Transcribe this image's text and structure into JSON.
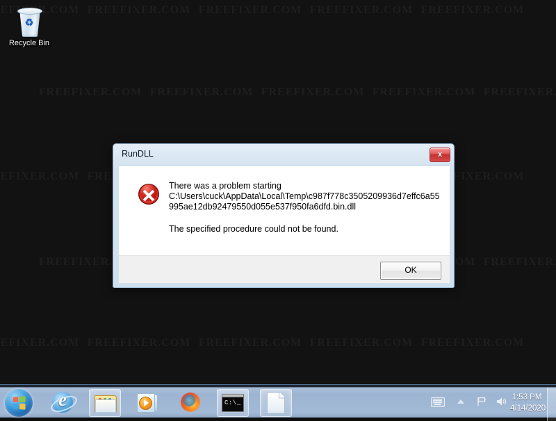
{
  "desktop": {
    "watermark_text": "FREEFIXER.COM",
    "background_color": "#121212",
    "icons": [
      {
        "name": "recycle-bin",
        "label": "Recycle Bin"
      }
    ]
  },
  "dialog": {
    "title": "RunDLL",
    "close_label": "x",
    "icon": "error-icon",
    "message_line1": "There was a problem starting",
    "message_path": "C:\\Users\\cuck\\AppData\\Local\\Temp\\c987f778c3505209936d7effc6a55995ae12db92479550d055e537f950fa6dfd.bin.dll",
    "message_line2": "The specified procedure could not be found.",
    "ok_label": "OK",
    "accent_color": "#cfe0ef",
    "error_color": "#c8261e"
  },
  "taskbar": {
    "start_label": "Start",
    "items": [
      {
        "name": "taskbar-internet-explorer",
        "label": "Internet Explorer",
        "pinned": false
      },
      {
        "name": "taskbar-windows-explorer",
        "label": "Windows Explorer",
        "pinned": true
      },
      {
        "name": "taskbar-windows-media-player",
        "label": "Windows Media Player",
        "pinned": false
      },
      {
        "name": "taskbar-firefox",
        "label": "Mozilla Firefox",
        "pinned": false
      },
      {
        "name": "taskbar-command-prompt",
        "label": "Command Prompt",
        "pinned": true
      },
      {
        "name": "taskbar-document",
        "label": "Document",
        "pinned": true
      }
    ],
    "tray": {
      "keyboard_icon": "keyboard-icon",
      "show_hidden_icon": "chevron-up-icon",
      "action_center_icon": "flag-icon",
      "volume_icon": "speaker-icon",
      "time": "1:53 PM",
      "date": "4/14/2020"
    }
  }
}
